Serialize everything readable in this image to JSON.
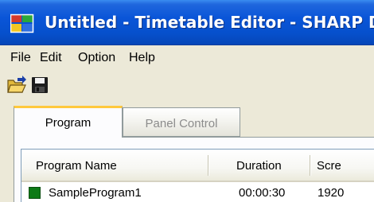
{
  "window": {
    "title": "Untitled - Timetable Editor - SHARP D"
  },
  "menu": {
    "items": [
      "File",
      "Edit",
      "Option",
      "Help"
    ]
  },
  "toolbar": {
    "buttons": [
      {
        "name": "open",
        "icon": "open-folder-icon"
      },
      {
        "name": "save",
        "icon": "save-disk-icon"
      }
    ]
  },
  "tabs": [
    {
      "label": "Program",
      "active": true
    },
    {
      "label": "Panel Control",
      "active": false
    }
  ],
  "program_list": {
    "columns": [
      "Program Name",
      "Duration",
      "Scre"
    ],
    "rows": [
      {
        "color": "#0e7a16",
        "name": "SampleProgram1",
        "duration": "00:00:30",
        "screen": "1920"
      }
    ]
  },
  "colors": {
    "titlebar_blue": "#0650cc",
    "active_tab_accent": "#ffc83c",
    "window_face": "#ece9d8"
  }
}
